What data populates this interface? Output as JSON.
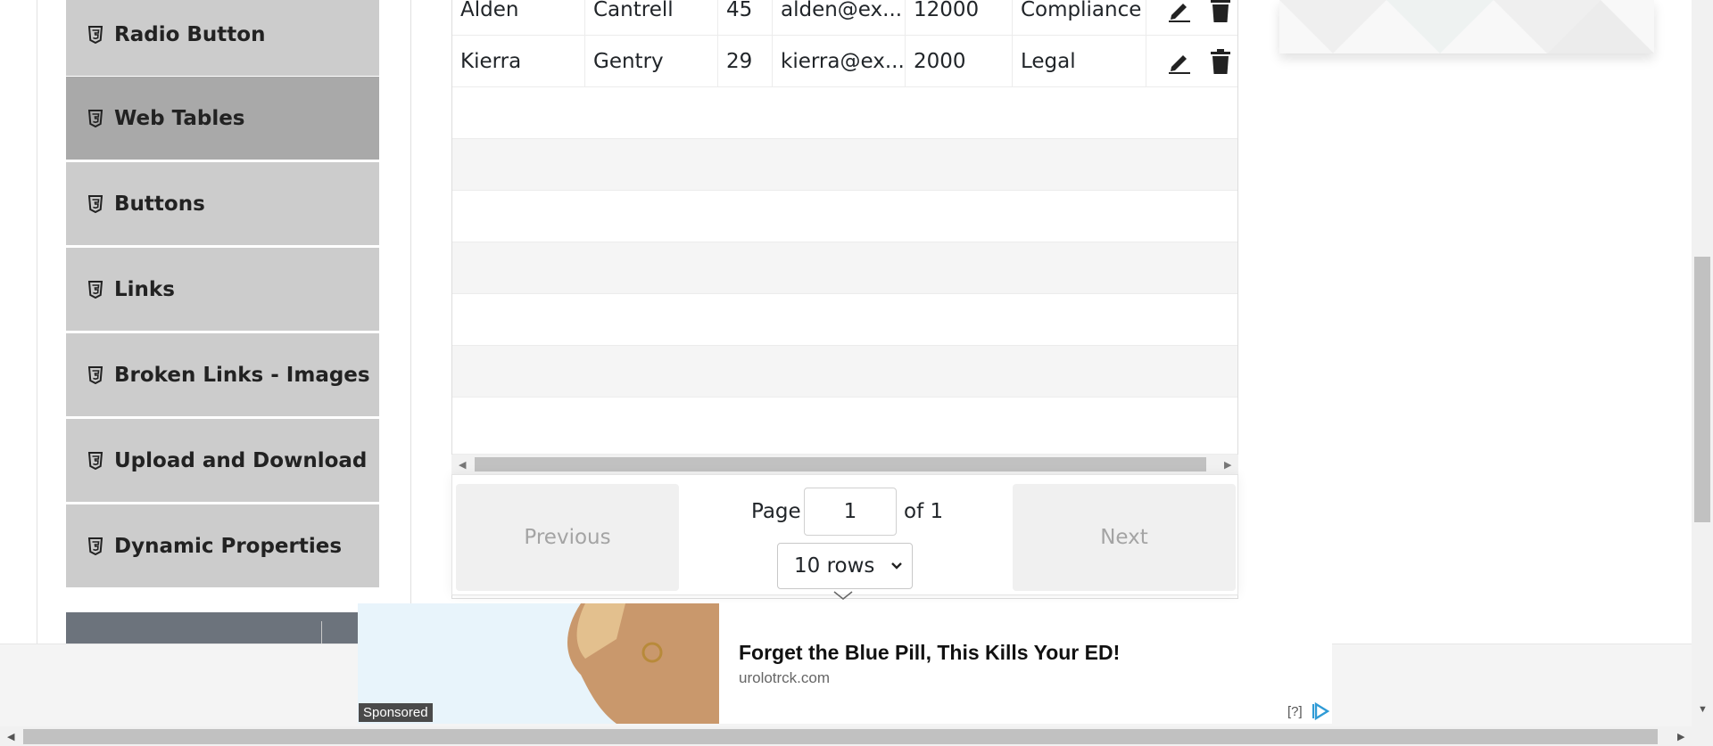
{
  "sidebar": {
    "items": [
      {
        "label": "Radio Button",
        "icon": "html5-icon",
        "active": false
      },
      {
        "label": "Web Tables",
        "icon": "html5-icon",
        "active": true
      },
      {
        "label": "Buttons",
        "icon": "html5-icon",
        "active": false
      },
      {
        "label": "Links",
        "icon": "html5-icon",
        "active": false
      },
      {
        "label": "Broken Links - Images",
        "icon": "html5-icon",
        "active": false
      },
      {
        "label": "Upload and Download",
        "icon": "html5-icon",
        "active": false
      },
      {
        "label": "Dynamic Properties",
        "icon": "html5-icon",
        "active": false
      }
    ]
  },
  "table": {
    "rows": [
      {
        "first_name": "Alden",
        "last_name": "Cantrell",
        "age": "45",
        "email": "alden@ex...",
        "salary": "12000",
        "department": "Compliance"
      },
      {
        "first_name": "Kierra",
        "last_name": "Gentry",
        "age": "29",
        "email": "kierra@ex...",
        "salary": "2000",
        "department": "Legal"
      }
    ],
    "edit_icon": "pencil-icon",
    "delete_icon": "trash-icon"
  },
  "pagination": {
    "previous_label": "Previous",
    "next_label": "Next",
    "page_label": "Page",
    "page_value": "1",
    "of_label": "of 1",
    "rows_label": "10 rows"
  },
  "ad": {
    "badge": "Sponsored",
    "title": "Forget the Blue Pill, This Kills Your ED!",
    "domain": "urolotrck.com",
    "help": "[?]"
  },
  "colors": {
    "sidebar_bg": "#cccccc",
    "sidebar_active_bg": "#a9a9a9",
    "ad_choice": "#2f9bd6"
  }
}
